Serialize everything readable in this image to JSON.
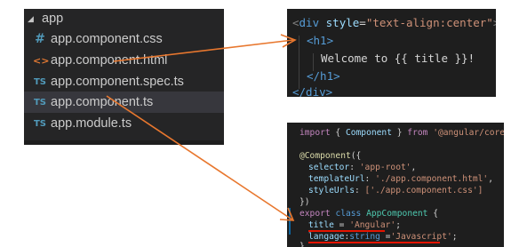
{
  "explorer": {
    "folder": "app",
    "files": [
      {
        "name": "app.component.css",
        "icon": "css-file-icon",
        "glyph": "#"
      },
      {
        "name": "app.component.html",
        "icon": "html-file-icon",
        "glyph": "<>"
      },
      {
        "name": "app.component.spec.ts",
        "icon": "ts-file-icon",
        "glyph": "TS"
      },
      {
        "name": "app.component.ts",
        "icon": "ts-file-icon",
        "glyph": "TS"
      },
      {
        "name": "app.module.ts",
        "icon": "ts-file-icon",
        "glyph": "TS"
      }
    ],
    "selected_index": 3
  },
  "html_code": {
    "open_tag_start": "<",
    "div_tag": "div",
    "style_attr": "style",
    "eq": "=",
    "style_value": "\"text-align:center\"",
    "close_bracket": ">",
    "h1_open": "<h1>",
    "h1_text": "Welcome to {{ title }}!",
    "h1_close": "</h1>",
    "div_close": "</div>"
  },
  "ts_code": {
    "l1_import": "import",
    "l1_brace_open": " { ",
    "l1_component": "Component",
    "l1_brace_close": " } ",
    "l1_from": "from",
    "l1_module": "'@angular/core'",
    "l1_semi": ";",
    "l3_decorator": "@Component",
    "l3_paren": "({",
    "l4_key": "selector",
    "l4_val": "'app-root'",
    "l5_key": "templateUrl",
    "l5_val": "'./app.component.html'",
    "l6_key": "styleUrls",
    "l6_val": "['./app.component.css']",
    "l7_close": "})",
    "l8_export": "export",
    "l8_class": "class",
    "l8_name": "AppComponent",
    "l8_brace": " {",
    "l9_key": "title",
    "l9_eq": " = ",
    "l9_val": "'Angular'",
    "l10_key": "langage",
    "l10_colon": ":",
    "l10_type": "string",
    "l10_eq": " =",
    "l10_val": "'Javascript'",
    "l11_close": "}"
  },
  "colors": {
    "arrow": "#e8772e",
    "underline": "#e51400"
  }
}
